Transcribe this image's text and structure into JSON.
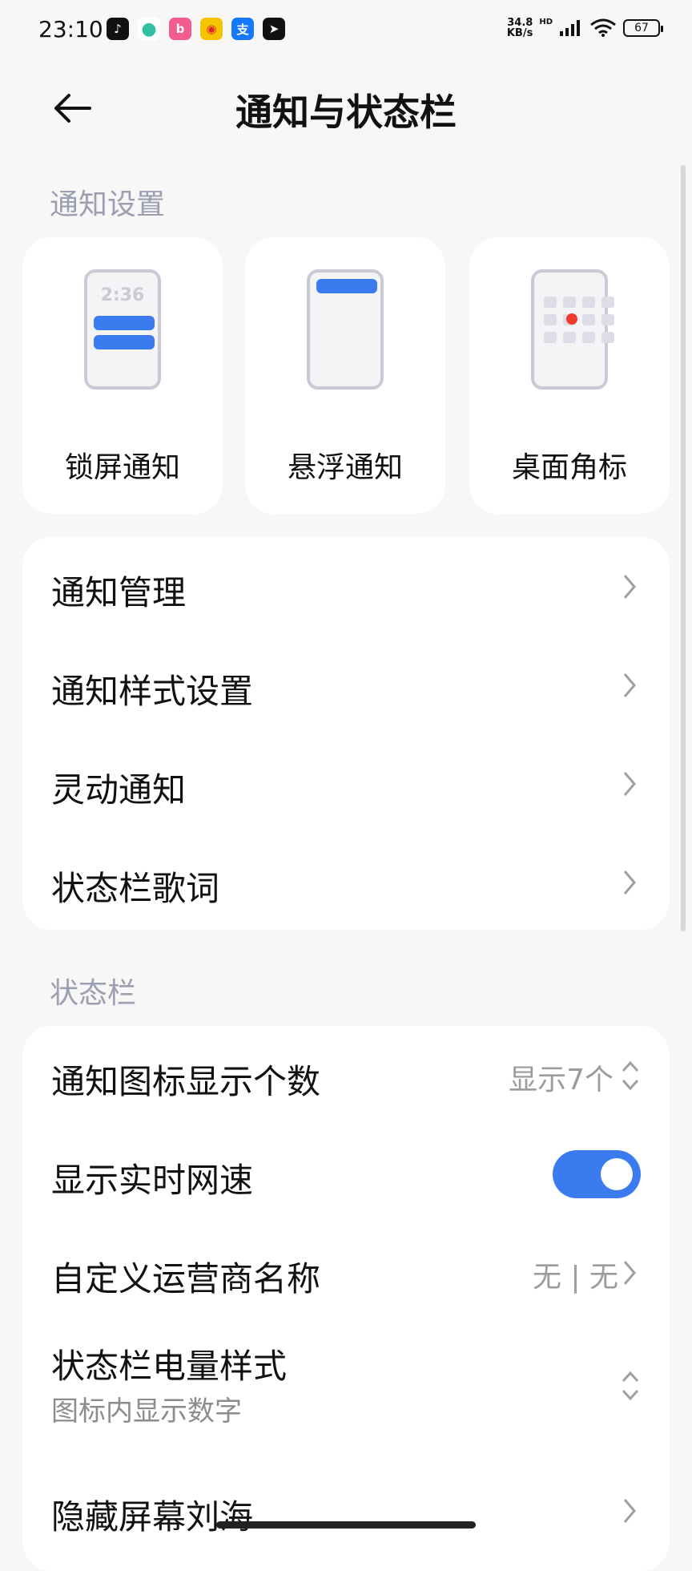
{
  "status_bar": {
    "time": "23:10",
    "speed_value": "34.8",
    "speed_unit": "KB/s",
    "hd": "HD",
    "battery": "67",
    "apps": [
      {
        "icon": "tiktok-icon",
        "glyph": "♪",
        "color": "#111111"
      },
      {
        "icon": "app-green-icon",
        "glyph": "●",
        "color": "#2fc1a2"
      },
      {
        "icon": "bilibili-icon",
        "glyph": "b",
        "color": "#f25d8e"
      },
      {
        "icon": "weibo-icon",
        "glyph": "◉",
        "color": "#f5c400"
      },
      {
        "icon": "alipay-icon",
        "glyph": "支",
        "color": "#1677ff"
      },
      {
        "icon": "app-arrow-icon",
        "glyph": "➤",
        "color": "#111111"
      }
    ]
  },
  "header": {
    "title": "通知与状态栏"
  },
  "sections": {
    "notification_settings": "通知设置",
    "status_bar": "状态栏"
  },
  "cards": [
    {
      "label": "锁屏通知",
      "phone_time": "2:36"
    },
    {
      "label": "悬浮通知"
    },
    {
      "label": "桌面角标"
    }
  ],
  "group1": [
    {
      "title": "通知管理"
    },
    {
      "title": "通知样式设置"
    },
    {
      "title": "灵动通知"
    },
    {
      "title": "状态栏歌词"
    }
  ],
  "group2": {
    "icon_count": {
      "title": "通知图标显示个数",
      "value": "显示7个"
    },
    "net_speed": {
      "title": "显示实时网速",
      "enabled": true
    },
    "carrier": {
      "title": "自定义运营商名称",
      "value": "无 | 无"
    },
    "battery_style": {
      "title": "状态栏电量样式",
      "subtitle": "图标内显示数字"
    },
    "hide_notch": {
      "title": "隐藏屏幕刘海"
    }
  },
  "colors": {
    "accent": "#3a7cf0",
    "badge": "#ee3a2f"
  }
}
